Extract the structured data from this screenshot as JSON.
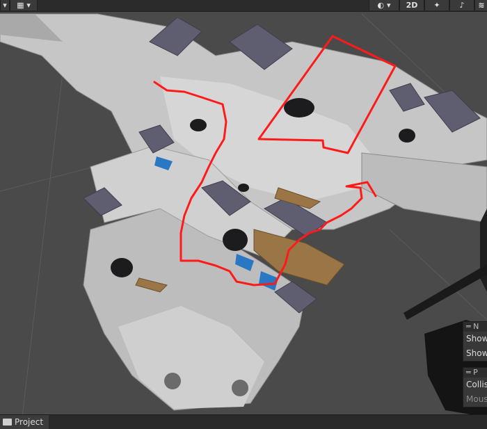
{
  "toolbar": {
    "left_tools": [
      {
        "icon": "dropdown-arrow-icon"
      },
      {
        "icon": "grid-icon"
      },
      {
        "icon": "chevron-down-icon"
      }
    ],
    "right_tools": [
      {
        "icon": "draw-mode-sphere-icon"
      },
      {
        "icon": "chevron-down-icon"
      },
      {
        "label": "2D"
      },
      {
        "icon": "lighting-icon"
      },
      {
        "icon": "audio-icon"
      },
      {
        "icon": "effects-icon"
      }
    ],
    "mode_2d_label": "2D"
  },
  "overlays": {
    "navigation_panel": {
      "header": "N",
      "rows": [
        "Show",
        "Show"
      ]
    },
    "physics_panel": {
      "header": "P",
      "rows": [
        "Collis",
        "Mous"
      ]
    }
  },
  "bottom": {
    "project_tab_label": "Project"
  },
  "annotation_color": "#ff1a1a"
}
